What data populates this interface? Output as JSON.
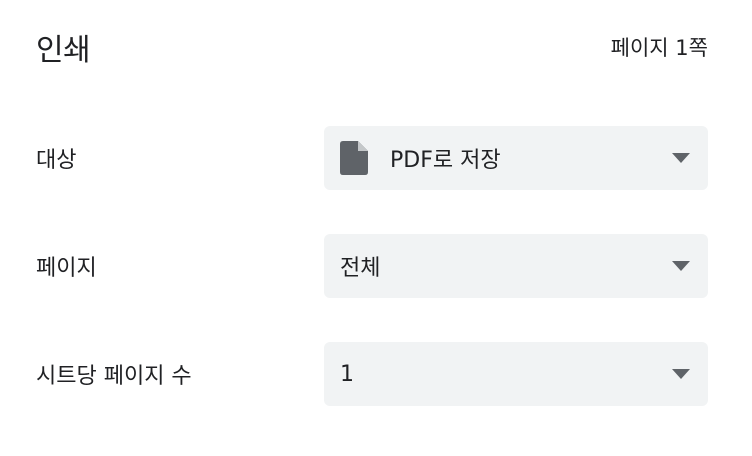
{
  "header": {
    "title": "인쇄",
    "page_count": "페이지 1쪽"
  },
  "settings": {
    "destination": {
      "label": "대상",
      "value": "PDF로 저장",
      "icon": "file-icon"
    },
    "pages": {
      "label": "페이지",
      "value": "전체"
    },
    "pages_per_sheet": {
      "label": "시트당 페이지 수",
      "value": "1"
    }
  },
  "colors": {
    "select_bg": "#f1f3f4",
    "text": "#202124",
    "icon": "#5f6368"
  }
}
